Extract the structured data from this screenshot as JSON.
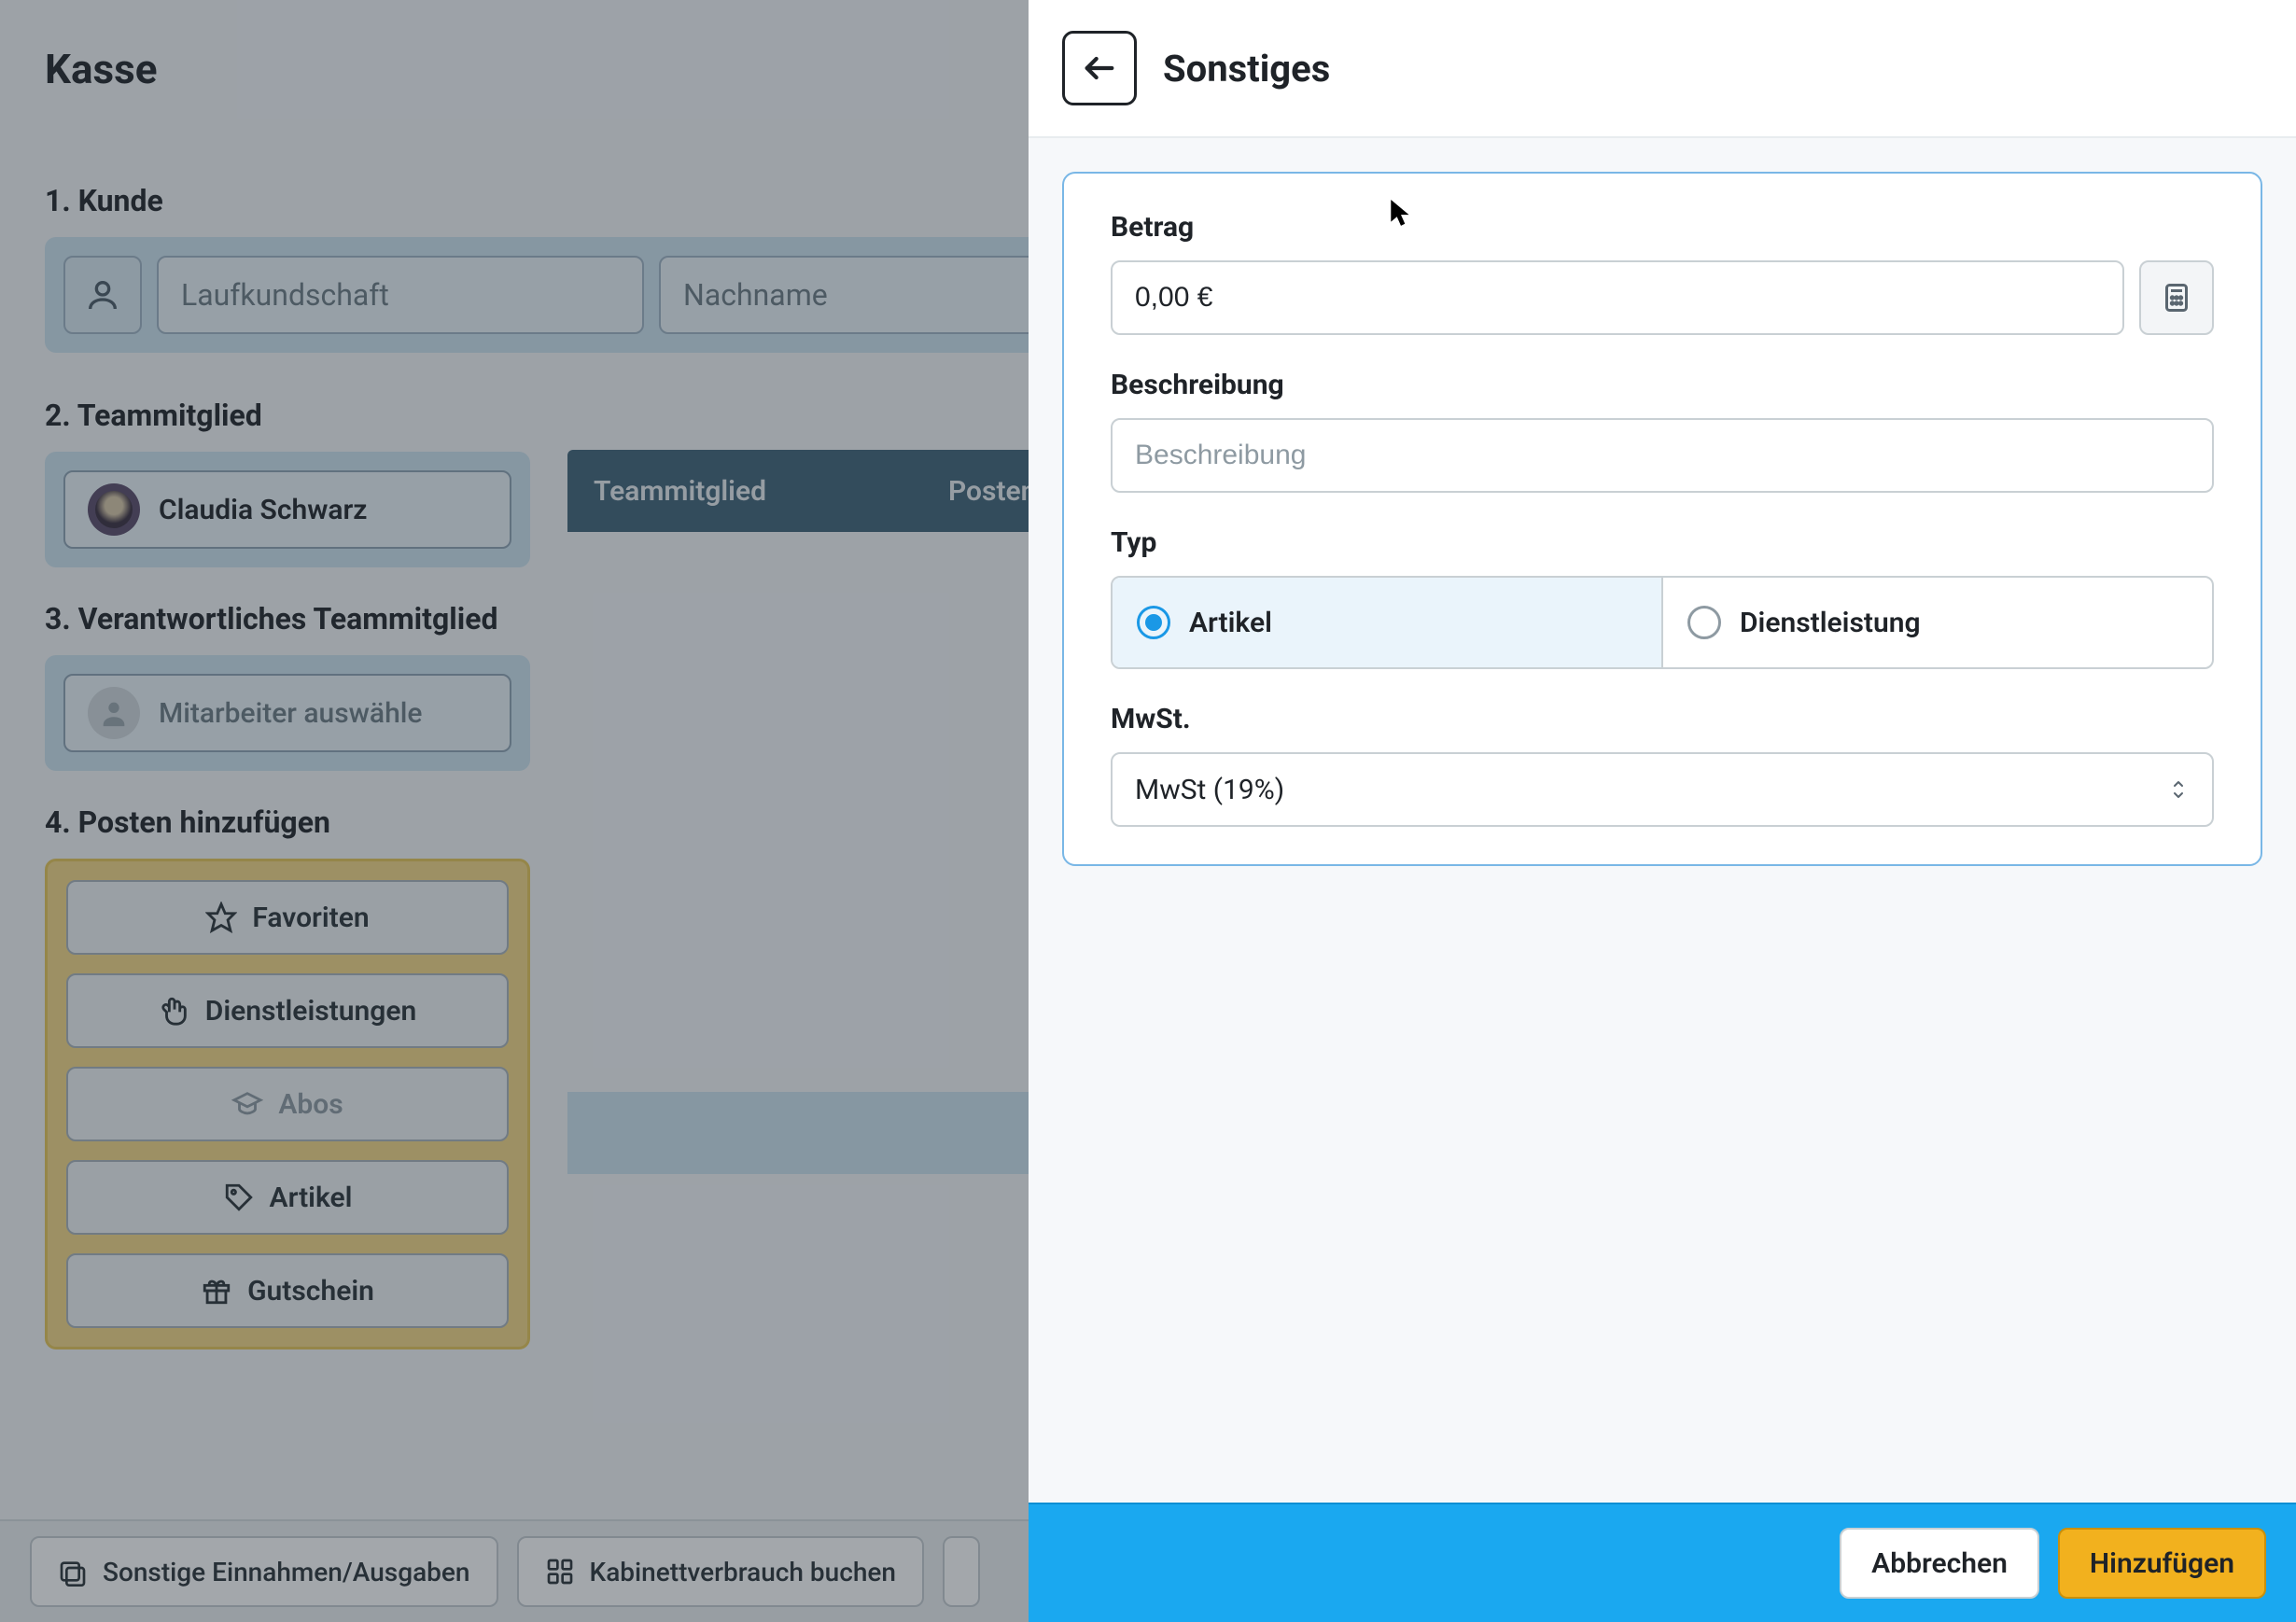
{
  "page": {
    "title": "Kasse"
  },
  "kunde": {
    "label": "1. Kunde",
    "vorname_placeholder": "Laufkundschaft",
    "nachname_placeholder": "Nachname"
  },
  "team": {
    "label": "2. Teammitglied",
    "member_name": "Claudia Schwarz"
  },
  "verantwortlich": {
    "label": "3. Verantwortliches Teammitglied",
    "select_placeholder": "Mitarbeiter auswähle"
  },
  "table": {
    "col_team": "Teammitglied",
    "col_posten": "Posten"
  },
  "posten": {
    "label": "4. Posten hinzufügen",
    "favoriten": "Favoriten",
    "dienstleistungen": "Dienstleistungen",
    "abos": "Abos",
    "artikel": "Artikel",
    "gutschein": "Gutschein"
  },
  "bottom": {
    "sonstige": "Sonstige Einnahmen/Ausgaben",
    "kabinett": "Kabinettverbrauch buchen"
  },
  "panel": {
    "title": "Sonstiges",
    "betrag_label": "Betrag",
    "betrag_value": "0,00 €",
    "beschreibung_label": "Beschreibung",
    "beschreibung_placeholder": "Beschreibung",
    "typ_label": "Typ",
    "typ_artikel": "Artikel",
    "typ_dienstleistung": "Dienstleistung",
    "mwst_label": "MwSt.",
    "mwst_value": "MwSt (19%)",
    "cancel": "Abbrechen",
    "add": "Hinzufügen"
  }
}
